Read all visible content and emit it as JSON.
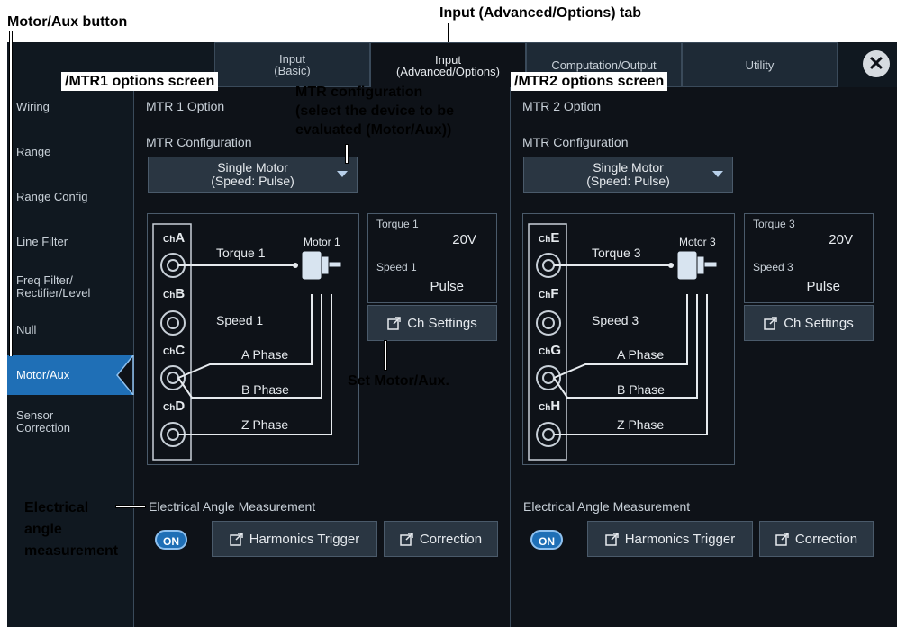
{
  "annotations": {
    "motor_aux_button": "Motor/Aux button",
    "input_adv_tab": "Input (Advanced/Options) tab",
    "mtr1_screen": "/MTR1 options screen",
    "mtr2_screen": "/MTR2 options screen",
    "mtr_config_line1": "MTR configuration",
    "mtr_config_line2": "(select the device to be",
    "mtr_config_line3": "evaluated (Motor/Aux))",
    "set_motor_aux": "Set Motor/Aux.",
    "elec_line1": "Electrical",
    "elec_line2": "angle",
    "elec_line3": "measurement"
  },
  "tabs": [
    {
      "line1": "Input",
      "line2": "(Basic)"
    },
    {
      "line1": "Input",
      "line2": "(Advanced/Options)"
    },
    {
      "line1": "Computation/Output",
      "line2": ""
    },
    {
      "line1": "Utility",
      "line2": ""
    }
  ],
  "close_symbol": "✕",
  "sidebar": {
    "items": [
      {
        "line1": "Wiring",
        "line2": ""
      },
      {
        "line1": "Range",
        "line2": ""
      },
      {
        "line1": "Range Config",
        "line2": ""
      },
      {
        "line1": "Line Filter",
        "line2": ""
      },
      {
        "line1": "Freq Filter/",
        "line2": "Rectifier/Level"
      },
      {
        "line1": "Null",
        "line2": ""
      },
      {
        "line1": "Motor/Aux",
        "line2": ""
      },
      {
        "line1": "Sensor",
        "line2": "Correction"
      }
    ]
  },
  "panels": [
    {
      "title": "MTR 1 Option",
      "config_label": "MTR Configuration",
      "config_line1": "Single Motor",
      "config_line2": "(Speed: Pulse)",
      "channels": [
        "A",
        "B",
        "C",
        "D"
      ],
      "ch_prefix": "Ch",
      "torque_wire": "Torque 1",
      "speed_wire": "Speed 1",
      "motor_label": "Motor 1",
      "phases": [
        "A Phase",
        "B Phase",
        "Z Phase"
      ],
      "info_torque_label": "Torque 1",
      "info_torque_value": "20V",
      "info_speed_label": "Speed 1",
      "info_speed_value": "Pulse",
      "ch_settings": "Ch Settings",
      "elec_label": "Electrical Angle Measurement",
      "toggle": "ON",
      "harmonics_trigger": "Harmonics Trigger",
      "correction": "Correction"
    },
    {
      "title": "MTR 2 Option",
      "config_label": "MTR Configuration",
      "config_line1": "Single Motor",
      "config_line2": "(Speed: Pulse)",
      "channels": [
        "E",
        "F",
        "G",
        "H"
      ],
      "ch_prefix": "Ch",
      "torque_wire": "Torque 3",
      "speed_wire": "Speed 3",
      "motor_label": "Motor 3",
      "phases": [
        "A Phase",
        "B Phase",
        "Z Phase"
      ],
      "info_torque_label": "Torque 3",
      "info_torque_value": "20V",
      "info_speed_label": "Speed 3",
      "info_speed_value": "Pulse",
      "ch_settings": "Ch Settings",
      "elec_label": "Electrical Angle Measurement",
      "toggle": "ON",
      "harmonics_trigger": "Harmonics Trigger",
      "correction": "Correction"
    }
  ],
  "colors": {
    "screen_bg": "#0e1218",
    "accent_blue": "#1f6fb6",
    "text": "#c8d0d8"
  }
}
